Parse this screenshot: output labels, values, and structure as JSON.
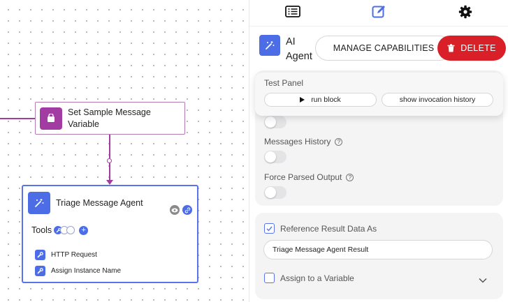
{
  "canvas": {
    "nodes": [
      {
        "title": "Set Sample Message Variable",
        "icon": "bucket-icon",
        "color": "#a23ca2"
      },
      {
        "title": "Triage Message Agent",
        "icon": "magic-wand-icon",
        "color": "#4d6de6",
        "tools_label": "Tools",
        "tools": [
          {
            "label": "HTTP Request",
            "icon": "wrench-icon"
          },
          {
            "label": "Assign Instance Name",
            "icon": "wrench-icon"
          }
        ]
      }
    ]
  },
  "panel": {
    "tabs": [
      {
        "name": "list",
        "icon": "list-icon"
      },
      {
        "name": "edit",
        "icon": "edit-icon",
        "active": true
      },
      {
        "name": "settings",
        "icon": "gear-icon"
      }
    ],
    "header": {
      "title": "AI Agent",
      "icon": "magic-wand-icon"
    },
    "manage_label": "MANAGE CAPABILITIES",
    "delete_label": "DELETE",
    "test_panel": {
      "label": "Test Panel",
      "run_label": "run block",
      "history_label": "show invocation history"
    },
    "messages_history_label": "Messages History",
    "force_parsed_label": "Force Parsed Output",
    "reference_label": "Reference Result Data As",
    "reference_value": "Triage Message Agent Result",
    "assign_label": "Assign to a Variable"
  },
  "colors": {
    "accent": "#4d6de6",
    "danger": "#d91f27",
    "edge": "#a23ca2"
  }
}
